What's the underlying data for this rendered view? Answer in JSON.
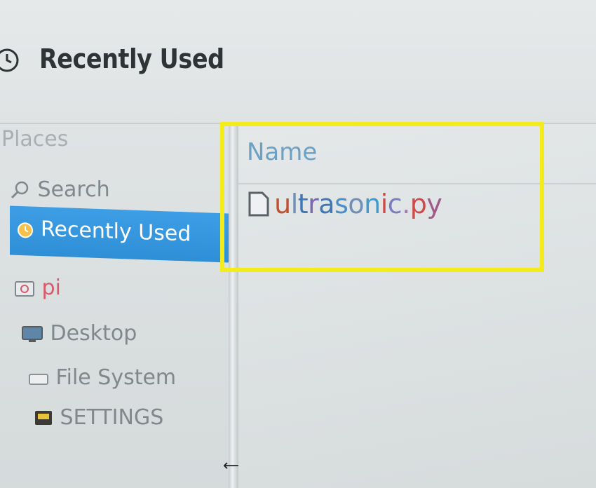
{
  "window": {
    "title": "Recently Used",
    "title_icon": "clock-icon"
  },
  "sidebar": {
    "heading": "Places",
    "items": [
      {
        "label": "Search",
        "icon": "search-icon"
      },
      {
        "label": "Recently Used",
        "icon": "clock-icon",
        "selected": true
      },
      {
        "label": "pi",
        "icon": "home-folder-icon"
      },
      {
        "label": "Desktop",
        "icon": "desktop-icon"
      },
      {
        "label": "File System",
        "icon": "drive-icon"
      },
      {
        "label": "SETTINGS",
        "icon": "usb-drive-icon"
      }
    ]
  },
  "file_list": {
    "columns": [
      "Name"
    ],
    "files": [
      {
        "name": "ultrasonic.py",
        "icon": "file-icon"
      }
    ]
  },
  "colors": {
    "selection": "#3197de",
    "highlight_box": "#f4ec1a",
    "column_header": "#6aa1c4"
  }
}
